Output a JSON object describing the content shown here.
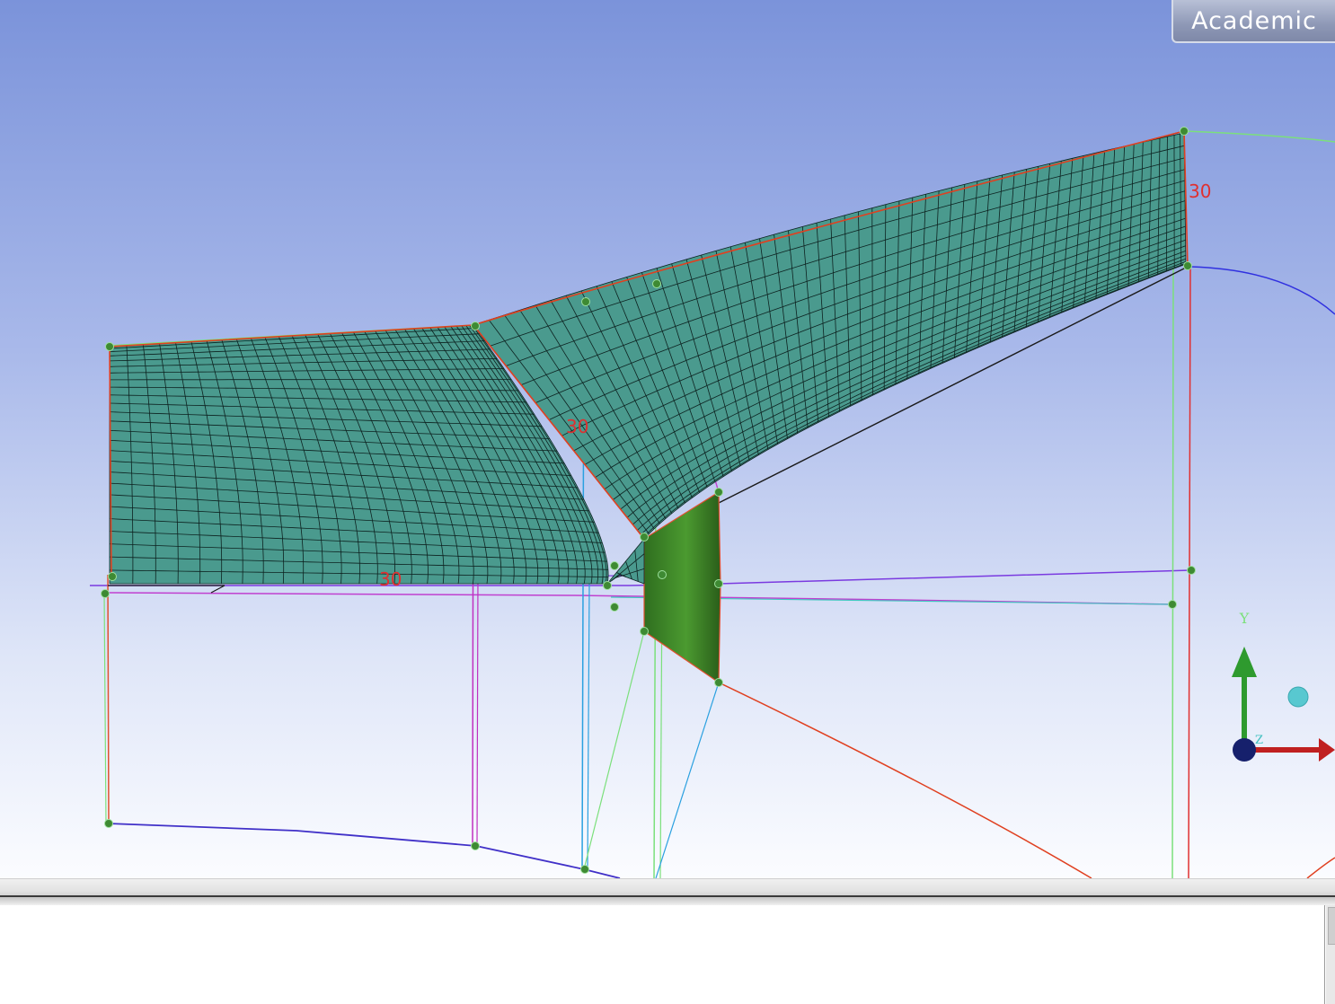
{
  "viewport": {
    "license_label": "Academic",
    "dimension_labels": [
      "30",
      "30",
      "30"
    ],
    "axis_triad": {
      "y_label": "Y",
      "z_label": "Z"
    },
    "colors": {
      "mesh_fill": "#4a9a8e",
      "mesh_line": "#0d2220",
      "solid_face": "#3f8a2a",
      "vertex": "#3e8a33",
      "axis_y": "#2e9a2e",
      "axis_x": "#c02020",
      "axis_z": "#16206c"
    }
  },
  "message_panel": {
    "text": ""
  }
}
